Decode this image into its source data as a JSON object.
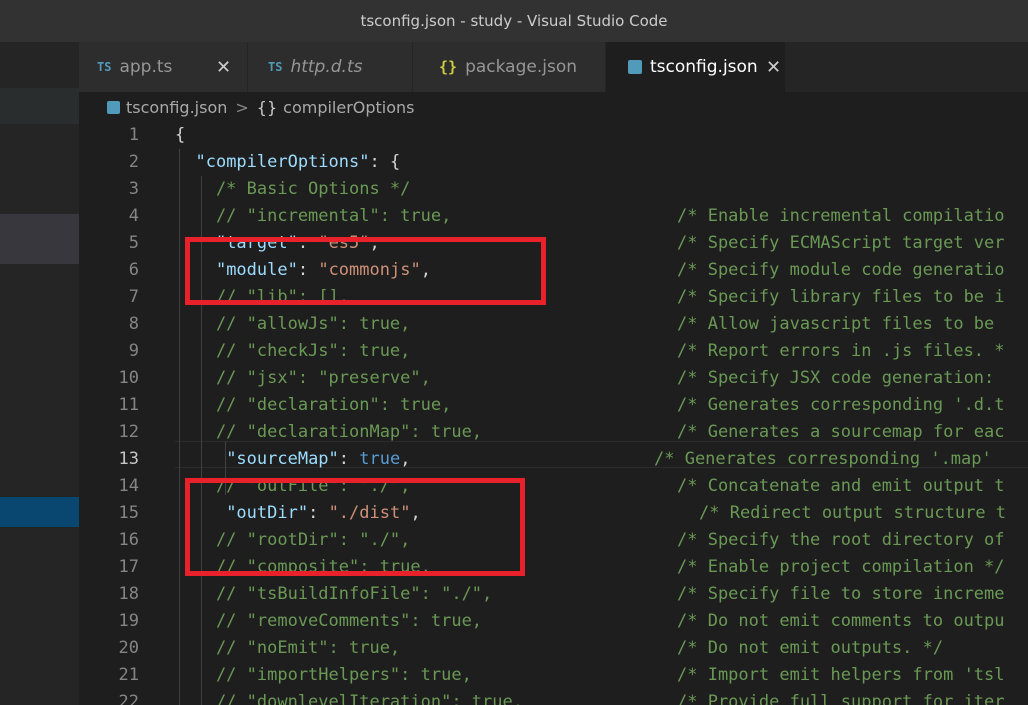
{
  "window": {
    "title": "tsconfig.json - study - Visual Studio Code"
  },
  "tabs": [
    {
      "icon": "TS",
      "label": "app.ts",
      "close": "✕"
    },
    {
      "icon": "TS",
      "label": "http.d.ts"
    },
    {
      "icon": "{}",
      "label": "package.json"
    },
    {
      "label": "tsconfig.json",
      "close": "✕"
    }
  ],
  "breadcrumb": {
    "file": "tsconfig.json",
    "separator": ">",
    "symbol_icon": "{}",
    "symbol": "compilerOptions"
  },
  "colors": {
    "highlight_box": "#e8212b",
    "key": "#9cdcfe",
    "string": "#ce9178",
    "boolean": "#569cd6",
    "comment": "#6a9955"
  },
  "lines": [
    {
      "n": "1",
      "code": "{"
    },
    {
      "n": "2",
      "code": "  \"compilerOptions\": {"
    },
    {
      "n": "3",
      "code": "    /* Basic Options */"
    },
    {
      "n": "4",
      "code": "    // \"incremental\": true,",
      "comment": "/* Enable incremental compilatio"
    },
    {
      "n": "5",
      "code": "    \"target\": \"es5\",",
      "comment": "/* Specify ECMAScript target ver"
    },
    {
      "n": "6",
      "code": "    \"module\": \"commonjs\",",
      "comment": "/* Specify module code generatio"
    },
    {
      "n": "7",
      "code": "    // \"lib\": [],",
      "comment": "/* Specify library files to be i"
    },
    {
      "n": "8",
      "code": "    // \"allowJs\": true,",
      "comment": "/* Allow javascript files to be"
    },
    {
      "n": "9",
      "code": "    // \"checkJs\": true,",
      "comment": "/* Report errors in .js files. *"
    },
    {
      "n": "10",
      "code": "    // \"jsx\": \"preserve\",",
      "comment": "/* Specify JSX code generation:"
    },
    {
      "n": "11",
      "code": "    // \"declaration\": true,",
      "comment": "/* Generates corresponding '.d.t"
    },
    {
      "n": "12",
      "code": "    // \"declarationMap\": true,",
      "comment": "/* Generates a sourcemap for eac"
    },
    {
      "n": "13",
      "code": "     \"sourceMap\": true,",
      "comment": "/* Generates corresponding '.map'"
    },
    {
      "n": "14",
      "code": "    // \"outFile\": \"./\",",
      "comment": "/* Concatenate and emit output t"
    },
    {
      "n": "15",
      "code": "     \"outDir\": \"./dist\",",
      "comment": "/* Redirect output structure t"
    },
    {
      "n": "16",
      "code": "    // \"rootDir\": \"./\",",
      "comment": "/* Specify the root directory of"
    },
    {
      "n": "17",
      "code": "    // \"composite\": true,",
      "comment": "/* Enable project compilation */"
    },
    {
      "n": "18",
      "code": "    // \"tsBuildInfoFile\": \"./\",",
      "comment": "/* Specify file to store increme"
    },
    {
      "n": "19",
      "code": "    // \"removeComments\": true,",
      "comment": "/* Do not emit comments to outpu"
    },
    {
      "n": "20",
      "code": "    // \"noEmit\": true,",
      "comment": "/* Do not emit outputs. */"
    },
    {
      "n": "21",
      "code": "    // \"importHelpers\": true,",
      "comment": "/* Import emit helpers from 'tsl"
    },
    {
      "n": "22",
      "code": "    // \"downlevelIteration\": true,",
      "comment": "/* Provide full support for iter"
    }
  ]
}
